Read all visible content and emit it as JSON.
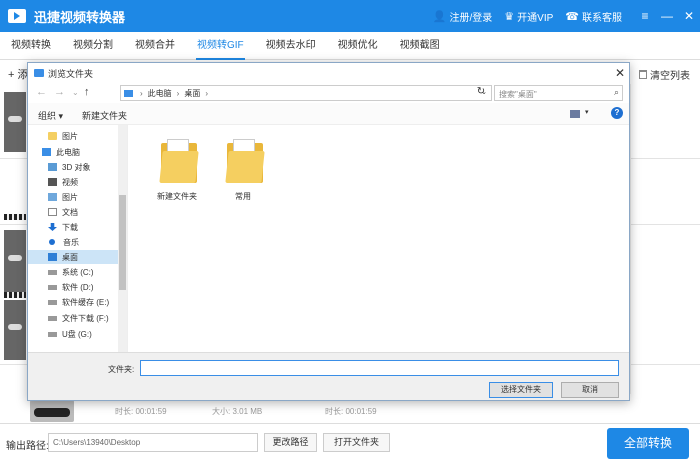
{
  "app": {
    "title": "迅捷视频转换器",
    "header_links": [
      {
        "icon": "user-icon",
        "label": "注册/登录"
      },
      {
        "icon": "vip-icon",
        "label": "开通VIP"
      },
      {
        "icon": "headset-icon",
        "label": "联系客服"
      }
    ],
    "window_controls": [
      "≡",
      "—",
      "✕"
    ]
  },
  "tabs": [
    {
      "label": "视频转换",
      "active": false
    },
    {
      "label": "视频分割",
      "active": false
    },
    {
      "label": "视频合并",
      "active": false
    },
    {
      "label": "视频转GIF",
      "active": true
    },
    {
      "label": "视频去水印",
      "active": false
    },
    {
      "label": "视频优化",
      "active": false
    },
    {
      "label": "视频截图",
      "active": false
    }
  ],
  "toolbar": {
    "add_label": "+ 添",
    "clear_label": "清空列表"
  },
  "file_row": {
    "duration_a": "时长: 00:01:59",
    "size_a": "大小: 3.01 MB",
    "duration_b": "时长: 00:01:59"
  },
  "bottom_bar": {
    "output_label": "输出路径:",
    "output_path": "C:\\Users\\13940\\Desktop",
    "change_path": "更改路径",
    "open_folder": "打开文件夹",
    "convert_all": "全部转换"
  },
  "dialog": {
    "title": "浏览文件夹",
    "close": "✕",
    "address": {
      "crumbs": [
        "此电脑",
        "桌面"
      ]
    },
    "search_placeholder": "搜索\"桌面\"",
    "commands": {
      "organize": "组织 ▾",
      "new_folder": "新建文件夹",
      "help": "?"
    },
    "nav_items": [
      {
        "icon": "folder",
        "label": "图片",
        "selected": false
      },
      {
        "icon": "pc",
        "label": "此电脑",
        "selected": false
      },
      {
        "icon": "obj",
        "label": "3D 对象",
        "selected": false
      },
      {
        "icon": "video",
        "label": "视频",
        "selected": false
      },
      {
        "icon": "pic",
        "label": "图片",
        "selected": false
      },
      {
        "icon": "doc",
        "label": "文档",
        "selected": false
      },
      {
        "icon": "down",
        "label": "下载",
        "selected": false
      },
      {
        "icon": "music",
        "label": "音乐",
        "selected": false
      },
      {
        "icon": "desk",
        "label": "桌面",
        "selected": true
      },
      {
        "icon": "drive",
        "label": "系统 (C:)",
        "selected": false
      },
      {
        "icon": "drive",
        "label": "软件 (D:)",
        "selected": false
      },
      {
        "icon": "drive",
        "label": "软件缓存 (E:)",
        "selected": false
      },
      {
        "icon": "drive",
        "label": "文件下载 (F:)",
        "selected": false
      },
      {
        "icon": "drive",
        "label": "U盘 (G:)",
        "selected": false
      }
    ],
    "files": [
      {
        "label": "新建文件夹"
      },
      {
        "label": "常用"
      }
    ],
    "folder_field_label": "文件夹:",
    "folder_field_value": "",
    "select_button": "选择文件夹",
    "cancel_button": "取消"
  }
}
